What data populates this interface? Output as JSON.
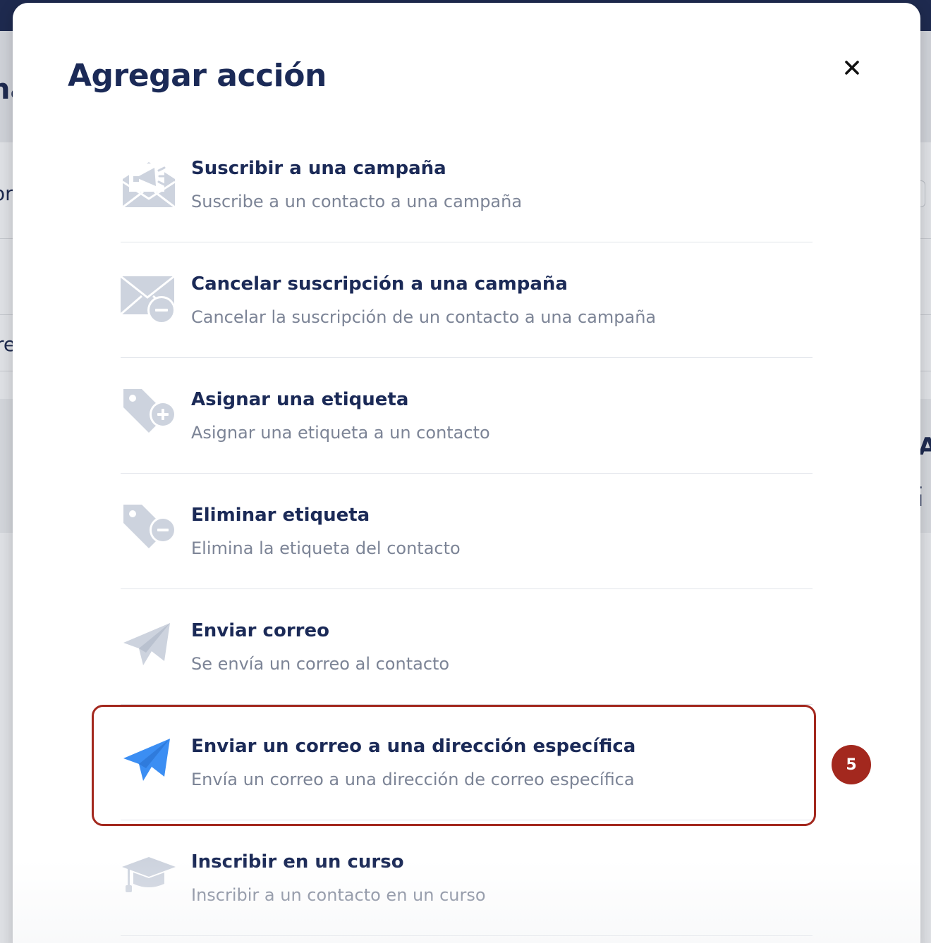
{
  "backdrop": {
    "fragments": [
      "na",
      "or",
      "re",
      "A",
      ". I"
    ]
  },
  "modal": {
    "title": "Agregar acción",
    "close_symbol": "×"
  },
  "actions": [
    {
      "title": "Suscribir a una campaña",
      "description": "Suscribe a un contacto a una campaña",
      "icon": "megaphone-envelope-icon"
    },
    {
      "title": "Cancelar suscripción a una campaña",
      "description": "Cancelar la suscripción de un contacto a una campaña",
      "icon": "envelope-minus-icon"
    },
    {
      "title": "Asignar una etiqueta",
      "description": "Asignar una etiqueta a un contacto",
      "icon": "tag-plus-icon"
    },
    {
      "title": "Eliminar etiqueta",
      "description": "Elimina la etiqueta del contacto",
      "icon": "tag-minus-icon"
    },
    {
      "title": "Enviar correo",
      "description": "Se envía un correo al contacto",
      "icon": "paper-plane-icon"
    },
    {
      "title": "Enviar un correo a una dirección específica",
      "description": "Envía un correo a una dirección de correo específica",
      "icon": "paper-plane-blue-icon"
    },
    {
      "title": "Inscribir en un curso",
      "description": "Inscribir a un contacto en un curso",
      "icon": "graduation-cap-icon"
    }
  ],
  "annotation": {
    "step_number": "5",
    "highlighted_item": "Enviar un correo a una dirección específica"
  },
  "colors": {
    "title_navy": "#1b2a57",
    "muted_text": "#7c8496",
    "icon_gray": "#cdd3de",
    "icon_blue": "#3b8ef3",
    "annotation_red": "#a3281e"
  }
}
